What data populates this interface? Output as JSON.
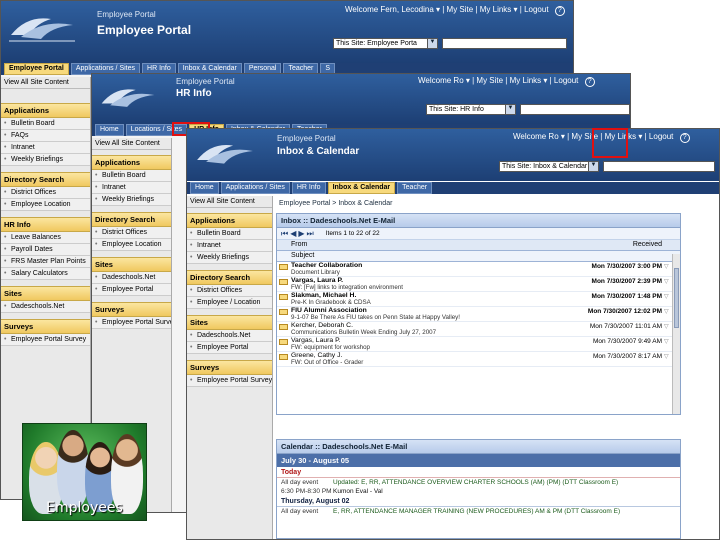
{
  "window1": {
    "portal_small": "Employee Portal",
    "portal_big": "Employee Portal",
    "toplinks": "Welcome Fern, Lecodina ▾ | My Site | My Links ▾ | Logout",
    "help": "?",
    "scope_value": "This Site: Employee Porta",
    "tabs": [
      "Employee Portal",
      "Applications / Sites",
      "HR Info",
      "Inbox & Calendar",
      "Personal",
      "Teacher",
      "S"
    ],
    "view_all": "View All Site Content",
    "nav": [
      {
        "heading": "Applications",
        "items": [
          "Bulletin Board",
          "FAQs",
          "Intranet",
          "Weekly Briefings"
        ]
      },
      {
        "heading": "Directory Search",
        "items": [
          "District Offices",
          "Employee Location"
        ]
      },
      {
        "heading": "HR Info",
        "items": [
          "Leave Balances",
          "Payroll Dates",
          "FRS Master Plan Points",
          "Salary Calculators"
        ]
      },
      {
        "heading": "Sites",
        "items": [
          "Dadeschools.Net"
        ]
      },
      {
        "heading": "Surveys",
        "items": [
          "Employee Portal Survey"
        ]
      }
    ]
  },
  "window2": {
    "portal_small": "Employee Portal",
    "portal_big": "HR Info",
    "toplinks": "Welcome Ro ▾ | My Site | My Links ▾ | Logout",
    "help": "?",
    "scope_value": "This Site: HR Info",
    "tabs": [
      "Home",
      "Locations / Sites",
      "HR Info",
      "Inbox & Calendar",
      "Teacher"
    ],
    "view_all": "View All Site Content",
    "nav": [
      {
        "heading": "Applications",
        "items": [
          "Bulletin Board",
          "Intranet",
          "Weekly Briefings"
        ]
      },
      {
        "heading": "Directory Search",
        "items": [
          "District Offices",
          "Employee Location"
        ]
      },
      {
        "heading": "Sites",
        "items": [
          "Dadeschools.Net",
          "Employee Portal"
        ]
      },
      {
        "heading": "Surveys",
        "items": [
          "Employee Portal Survey"
        ]
      }
    ]
  },
  "window3": {
    "portal_small": "Employee Portal",
    "portal_big": "Inbox & Calendar",
    "toplinks": "Welcome Ro ▾ | My Site | My Links ▾ | Logout",
    "help": "?",
    "scope_value": "This Site: Inbox & Calendar",
    "tabs": [
      "Home",
      "Applications / Sites",
      "HR Info",
      "Inbox & Calendar",
      "Teacher"
    ],
    "view_all": "View All Site Content",
    "nav": [
      {
        "heading": "Applications",
        "items": [
          "Bulletin Board",
          "Intranet",
          "Weekly Briefings"
        ]
      },
      {
        "heading": "Directory Search",
        "items": [
          "District Offices",
          "Employee / Location"
        ]
      },
      {
        "heading": "Sites",
        "items": [
          "Dadeschools.Net",
          "Employee Portal"
        ]
      },
      {
        "heading": "Surveys",
        "items": [
          "Employee Portal Surveys"
        ]
      }
    ],
    "breadcrumb": "Employee Portal > Inbox & Calendar",
    "inbox": {
      "title": "Inbox :: Dadeschools.Net E-Mail",
      "items_text": "Items  1 to 22 of 22",
      "col_from": "From",
      "col_subject": "Subject",
      "col_received": "Received",
      "rows": [
        {
          "from": "Teacher Collaboration",
          "subject": "Document Library",
          "date": "Mon 7/30/2007 3:00 PM",
          "unread": true
        },
        {
          "from": "Vargas, Laura P.",
          "subject": "FW: [Fw] links to integration environment",
          "date": "Mon 7/30/2007 2:39 PM",
          "unread": true
        },
        {
          "from": "Slakman, Michael H.",
          "subject": "Pre-K In Gradebook & CDSA",
          "date": "Mon 7/30/2007 1:48 PM",
          "unread": true
        },
        {
          "from": "FIU Alumni Association",
          "subject": "9-1-07 Be There As FIU takes on Penn State at Happy Valley!",
          "date": "Mon 7/30/2007 12:02 PM",
          "unread": true
        },
        {
          "from": "Kercher, Deborah C.",
          "subject": "Communications Bulletin Week Ending July 27, 2007",
          "date": "Mon 7/30/2007 11:01 AM",
          "unread": false
        },
        {
          "from": "Vargas, Laura P.",
          "subject": "FW: equipment for workshop",
          "date": "Mon 7/30/2007 9:49 AM",
          "unread": false
        },
        {
          "from": "Greene, Cathy J.",
          "subject": "FW: Out of Office - Grader",
          "date": "Mon 7/30/2007 8:17 AM",
          "unread": false
        }
      ]
    },
    "calendar": {
      "title": "Calendar :: Dadeschools.Net E-Mail",
      "range": "July 30 - August 05",
      "days": [
        {
          "label": "Today",
          "color": "red",
          "events": [
            {
              "time": "All day event",
              "desc": "Updated: E, RR, ATTENDANCE OVERVIEW CHARTER SCHOOLS (AM) (PM) (DTT Classroom E)"
            },
            {
              "time": "6:30 PM-8:30 PM",
              "desc": "Kumon Eval - Val"
            }
          ]
        },
        {
          "label": "Thursday, August 02",
          "color": "black",
          "events": [
            {
              "time": "All day event",
              "desc": "E, RR, ATTENDANCE MANAGER TRAINING (NEW PROCEDURES) AM & PM (DTT Classroom E)"
            }
          ]
        }
      ]
    }
  },
  "photo": {
    "caption": "Employees"
  },
  "colors": {
    "header": "#2f5f9e",
    "tab_bar": "#1f3f74",
    "active_tab": "#f7d97c",
    "highlight": "#e01010"
  }
}
